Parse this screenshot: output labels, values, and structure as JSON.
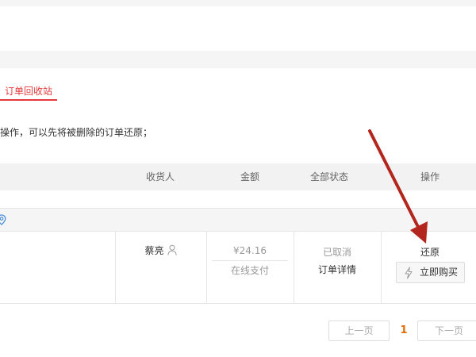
{
  "tabs": {
    "recycle_bin": "订单回收站"
  },
  "hint": "操作，可以先将被删除的订单还原；",
  "table_header": {
    "receiver": "收货人",
    "amount": "金额",
    "status": "全部状态",
    "action": "操作"
  },
  "order": {
    "receiver": "蔡亮",
    "price": "¥24.16",
    "payment_method": "在线支付",
    "status": "已取消",
    "detail_link": "订单详情",
    "restore_link": "还原",
    "buy_again": "立即购买"
  },
  "pagination": {
    "prev": "上一页",
    "current": "1",
    "next": "下一页"
  },
  "colors": {
    "accent": "#e4393c",
    "annotation_arrow": "#b3261e",
    "current_page": "#e36c09"
  },
  "icons": {
    "header_pin": "location-pin-icon",
    "receiver": "user-icon",
    "buy": "lightning-icon"
  }
}
